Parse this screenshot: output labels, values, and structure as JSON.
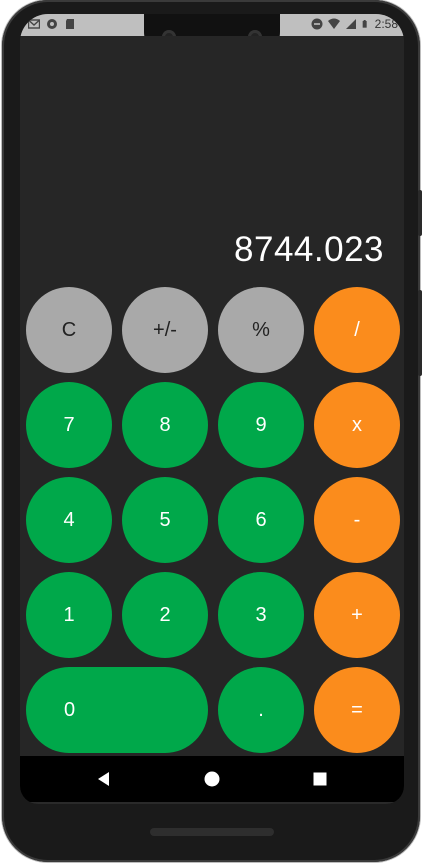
{
  "status": {
    "time": "2:58",
    "left_icons": [
      "gmail-icon",
      "circle-icon",
      "sd-card-icon"
    ],
    "right_icons": [
      "dnd-icon",
      "wifi-icon",
      "signal-icon",
      "battery-icon"
    ]
  },
  "display": {
    "value": "8744.023"
  },
  "keys": {
    "clear": "C",
    "sign": "+/-",
    "percent": "%",
    "divide": "/",
    "seven": "7",
    "eight": "8",
    "nine": "9",
    "multiply": "x",
    "four": "4",
    "five": "5",
    "six": "6",
    "subtract": "-",
    "one": "1",
    "two": "2",
    "three": "3",
    "add": "+",
    "zero": "0",
    "decimal": ".",
    "equals": "="
  },
  "colors": {
    "function_key": "#a9a9a9",
    "digit_key": "#00a84a",
    "operator_key": "#fb8c1c",
    "background": "#262626"
  },
  "nav": {
    "icons": [
      "back-icon",
      "home-icon",
      "recents-icon"
    ]
  }
}
